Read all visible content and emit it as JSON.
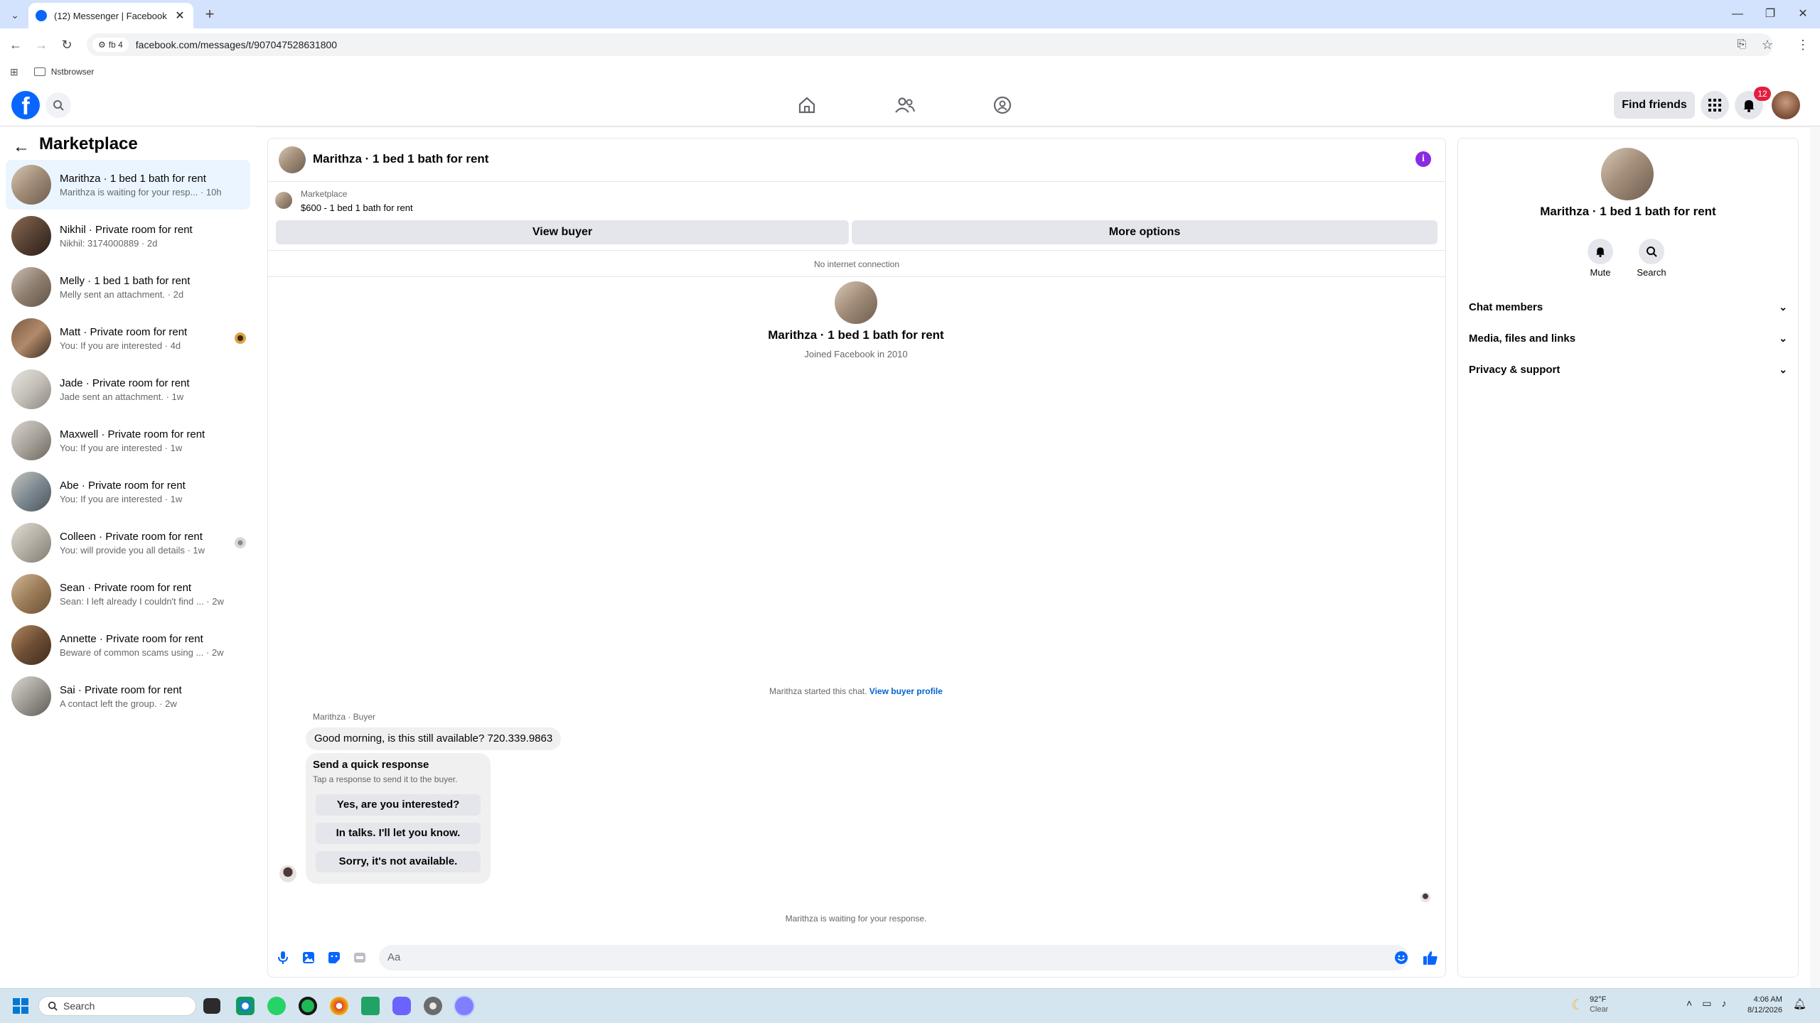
{
  "browser": {
    "tab_title": "(12) Messenger | Facebook",
    "new_tab": "+",
    "profile_chip": "fb 4",
    "url": "facebook.com/messages/t/907047528631800",
    "bookmark": "Nstbrowser"
  },
  "header": {
    "find_friends": "Find friends",
    "notification_count": "12"
  },
  "sidebar": {
    "back": "←",
    "title": "Marketplace",
    "conversations": [
      {
        "name": "Marithza · 1 bed 1 bath for rent",
        "preview": "Marithza is waiting for your resp... · 10h",
        "active": true
      },
      {
        "name": "Nikhil · Private room for rent",
        "preview": "Nikhil: 3174000889 · 2d"
      },
      {
        "name": "Melly · 1 bed 1 bath for rent",
        "preview": "Melly sent an attachment. · 2d"
      },
      {
        "name": "Matt · Private room for rent",
        "preview": "You: If you are interested · 4d"
      },
      {
        "name": "Jade · Private room for rent",
        "preview": "Jade sent an attachment. · 1w"
      },
      {
        "name": "Maxwell · Private room for rent",
        "preview": "You: If you are interested · 1w"
      },
      {
        "name": "Abe · Private room for rent",
        "preview": "You: If you are interested · 1w"
      },
      {
        "name": "Colleen · Private room for rent",
        "preview": "You: will provide you all details · 1w"
      },
      {
        "name": "Sean · Private room for rent",
        "preview": "Sean: I left already I couldn't find ... · 2w"
      },
      {
        "name": "Annette · Private room for rent",
        "preview": "Beware of common scams using ... · 2w"
      },
      {
        "name": "Sai · Private room for rent",
        "preview": "A contact left the group. · 2w"
      }
    ]
  },
  "chat": {
    "title": "Marithza · 1 bed 1 bath for rent",
    "marketplace_label": "Marketplace",
    "listing": "$600 - 1 bed 1 bath for rent",
    "view_buyer": "View buyer",
    "more_options": "More options",
    "no_internet": "No internet connection",
    "profile_name": "Marithza · 1 bed 1 bath for rent",
    "joined": "Joined Facebook in 2010",
    "started_text": "Marithza started this chat.",
    "view_buyer_profile": "View buyer profile",
    "sender_label": "Marithza · Buyer",
    "message": "Good morning, is this still available? 720.339.9863",
    "quick_title": "Send a quick response",
    "quick_subtitle": "Tap a response to send it to the buyer.",
    "quick_responses": [
      "Yes, are you interested?",
      "In talks. I'll let you know.",
      "Sorry, it's not available."
    ],
    "waiting": "Marithza is waiting for your response.",
    "composer_placeholder": "Aa"
  },
  "info_panel": {
    "name": "Marithza · 1 bed 1 bath for rent",
    "mute": "Mute",
    "search": "Search",
    "sections": [
      "Chat members",
      "Media, files and links",
      "Privacy & support"
    ]
  },
  "taskbar": {
    "search": "Search",
    "temperature": "92°F",
    "condition": "Clear",
    "time": "4:06 AM",
    "date": "8/12/2026"
  },
  "colors": {
    "facebook_blue": "#0866ff",
    "active_conversation": "#ebf5ff",
    "link": "#0064d1",
    "badge_red": "#e41e3f"
  }
}
